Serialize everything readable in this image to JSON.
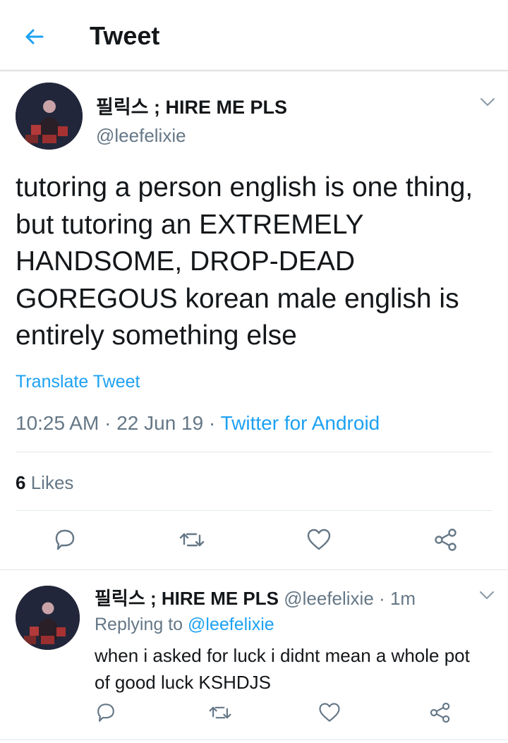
{
  "header": {
    "title": "Tweet",
    "back_icon": "arrow-left-icon",
    "accent_color": "#1da1f2"
  },
  "main_tweet": {
    "display_name": "필릭스 ; HIRE ME PLS",
    "handle": "@leefelixie",
    "text": "tutoring a person english is one thing, but tutoring an EXTREMELY HANDSOME, DROP-DEAD GOREGOUS korean male english is entirely something else",
    "translate_label": "Translate Tweet",
    "time": "10:25 AM",
    "date": "22 Jun 19",
    "separator": "·",
    "source": "Twitter for Android",
    "likes_count": "6",
    "likes_label": "Likes",
    "actions": [
      "reply-icon",
      "retweet-icon",
      "like-icon",
      "share-icon"
    ]
  },
  "reply_tweet": {
    "display_name": "필릭스 ; HIRE ME PLS",
    "handle": "@leefelixie",
    "separator": "·",
    "time_ago": "1m",
    "replying_label": "Replying to",
    "replying_to": "@leefelixie",
    "text": "when i asked for luck i didnt mean a whole pot of good luck KSHDJS",
    "actions": [
      "reply-icon",
      "retweet-icon",
      "like-icon",
      "share-icon"
    ]
  }
}
